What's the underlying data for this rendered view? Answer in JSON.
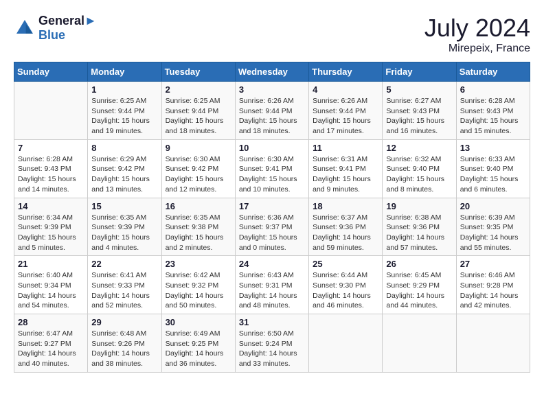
{
  "header": {
    "logo_line1": "General",
    "logo_line2": "Blue",
    "month": "July 2024",
    "location": "Mirepeix, France"
  },
  "weekdays": [
    "Sunday",
    "Monday",
    "Tuesday",
    "Wednesday",
    "Thursday",
    "Friday",
    "Saturday"
  ],
  "weeks": [
    [
      {
        "day": "",
        "sunrise": "",
        "sunset": "",
        "daylight": ""
      },
      {
        "day": "1",
        "sunrise": "Sunrise: 6:25 AM",
        "sunset": "Sunset: 9:44 PM",
        "daylight": "Daylight: 15 hours and 19 minutes."
      },
      {
        "day": "2",
        "sunrise": "Sunrise: 6:25 AM",
        "sunset": "Sunset: 9:44 PM",
        "daylight": "Daylight: 15 hours and 18 minutes."
      },
      {
        "day": "3",
        "sunrise": "Sunrise: 6:26 AM",
        "sunset": "Sunset: 9:44 PM",
        "daylight": "Daylight: 15 hours and 18 minutes."
      },
      {
        "day": "4",
        "sunrise": "Sunrise: 6:26 AM",
        "sunset": "Sunset: 9:44 PM",
        "daylight": "Daylight: 15 hours and 17 minutes."
      },
      {
        "day": "5",
        "sunrise": "Sunrise: 6:27 AM",
        "sunset": "Sunset: 9:43 PM",
        "daylight": "Daylight: 15 hours and 16 minutes."
      },
      {
        "day": "6",
        "sunrise": "Sunrise: 6:28 AM",
        "sunset": "Sunset: 9:43 PM",
        "daylight": "Daylight: 15 hours and 15 minutes."
      }
    ],
    [
      {
        "day": "7",
        "sunrise": "Sunrise: 6:28 AM",
        "sunset": "Sunset: 9:43 PM",
        "daylight": "Daylight: 15 hours and 14 minutes."
      },
      {
        "day": "8",
        "sunrise": "Sunrise: 6:29 AM",
        "sunset": "Sunset: 9:42 PM",
        "daylight": "Daylight: 15 hours and 13 minutes."
      },
      {
        "day": "9",
        "sunrise": "Sunrise: 6:30 AM",
        "sunset": "Sunset: 9:42 PM",
        "daylight": "Daylight: 15 hours and 12 minutes."
      },
      {
        "day": "10",
        "sunrise": "Sunrise: 6:30 AM",
        "sunset": "Sunset: 9:41 PM",
        "daylight": "Daylight: 15 hours and 10 minutes."
      },
      {
        "day": "11",
        "sunrise": "Sunrise: 6:31 AM",
        "sunset": "Sunset: 9:41 PM",
        "daylight": "Daylight: 15 hours and 9 minutes."
      },
      {
        "day": "12",
        "sunrise": "Sunrise: 6:32 AM",
        "sunset": "Sunset: 9:40 PM",
        "daylight": "Daylight: 15 hours and 8 minutes."
      },
      {
        "day": "13",
        "sunrise": "Sunrise: 6:33 AM",
        "sunset": "Sunset: 9:40 PM",
        "daylight": "Daylight: 15 hours and 6 minutes."
      }
    ],
    [
      {
        "day": "14",
        "sunrise": "Sunrise: 6:34 AM",
        "sunset": "Sunset: 9:39 PM",
        "daylight": "Daylight: 15 hours and 5 minutes."
      },
      {
        "day": "15",
        "sunrise": "Sunrise: 6:35 AM",
        "sunset": "Sunset: 9:39 PM",
        "daylight": "Daylight: 15 hours and 4 minutes."
      },
      {
        "day": "16",
        "sunrise": "Sunrise: 6:35 AM",
        "sunset": "Sunset: 9:38 PM",
        "daylight": "Daylight: 15 hours and 2 minutes."
      },
      {
        "day": "17",
        "sunrise": "Sunrise: 6:36 AM",
        "sunset": "Sunset: 9:37 PM",
        "daylight": "Daylight: 15 hours and 0 minutes."
      },
      {
        "day": "18",
        "sunrise": "Sunrise: 6:37 AM",
        "sunset": "Sunset: 9:36 PM",
        "daylight": "Daylight: 14 hours and 59 minutes."
      },
      {
        "day": "19",
        "sunrise": "Sunrise: 6:38 AM",
        "sunset": "Sunset: 9:36 PM",
        "daylight": "Daylight: 14 hours and 57 minutes."
      },
      {
        "day": "20",
        "sunrise": "Sunrise: 6:39 AM",
        "sunset": "Sunset: 9:35 PM",
        "daylight": "Daylight: 14 hours and 55 minutes."
      }
    ],
    [
      {
        "day": "21",
        "sunrise": "Sunrise: 6:40 AM",
        "sunset": "Sunset: 9:34 PM",
        "daylight": "Daylight: 14 hours and 54 minutes."
      },
      {
        "day": "22",
        "sunrise": "Sunrise: 6:41 AM",
        "sunset": "Sunset: 9:33 PM",
        "daylight": "Daylight: 14 hours and 52 minutes."
      },
      {
        "day": "23",
        "sunrise": "Sunrise: 6:42 AM",
        "sunset": "Sunset: 9:32 PM",
        "daylight": "Daylight: 14 hours and 50 minutes."
      },
      {
        "day": "24",
        "sunrise": "Sunrise: 6:43 AM",
        "sunset": "Sunset: 9:31 PM",
        "daylight": "Daylight: 14 hours and 48 minutes."
      },
      {
        "day": "25",
        "sunrise": "Sunrise: 6:44 AM",
        "sunset": "Sunset: 9:30 PM",
        "daylight": "Daylight: 14 hours and 46 minutes."
      },
      {
        "day": "26",
        "sunrise": "Sunrise: 6:45 AM",
        "sunset": "Sunset: 9:29 PM",
        "daylight": "Daylight: 14 hours and 44 minutes."
      },
      {
        "day": "27",
        "sunrise": "Sunrise: 6:46 AM",
        "sunset": "Sunset: 9:28 PM",
        "daylight": "Daylight: 14 hours and 42 minutes."
      }
    ],
    [
      {
        "day": "28",
        "sunrise": "Sunrise: 6:47 AM",
        "sunset": "Sunset: 9:27 PM",
        "daylight": "Daylight: 14 hours and 40 minutes."
      },
      {
        "day": "29",
        "sunrise": "Sunrise: 6:48 AM",
        "sunset": "Sunset: 9:26 PM",
        "daylight": "Daylight: 14 hours and 38 minutes."
      },
      {
        "day": "30",
        "sunrise": "Sunrise: 6:49 AM",
        "sunset": "Sunset: 9:25 PM",
        "daylight": "Daylight: 14 hours and 36 minutes."
      },
      {
        "day": "31",
        "sunrise": "Sunrise: 6:50 AM",
        "sunset": "Sunset: 9:24 PM",
        "daylight": "Daylight: 14 hours and 33 minutes."
      },
      {
        "day": "",
        "sunrise": "",
        "sunset": "",
        "daylight": ""
      },
      {
        "day": "",
        "sunrise": "",
        "sunset": "",
        "daylight": ""
      },
      {
        "day": "",
        "sunrise": "",
        "sunset": "",
        "daylight": ""
      }
    ]
  ]
}
